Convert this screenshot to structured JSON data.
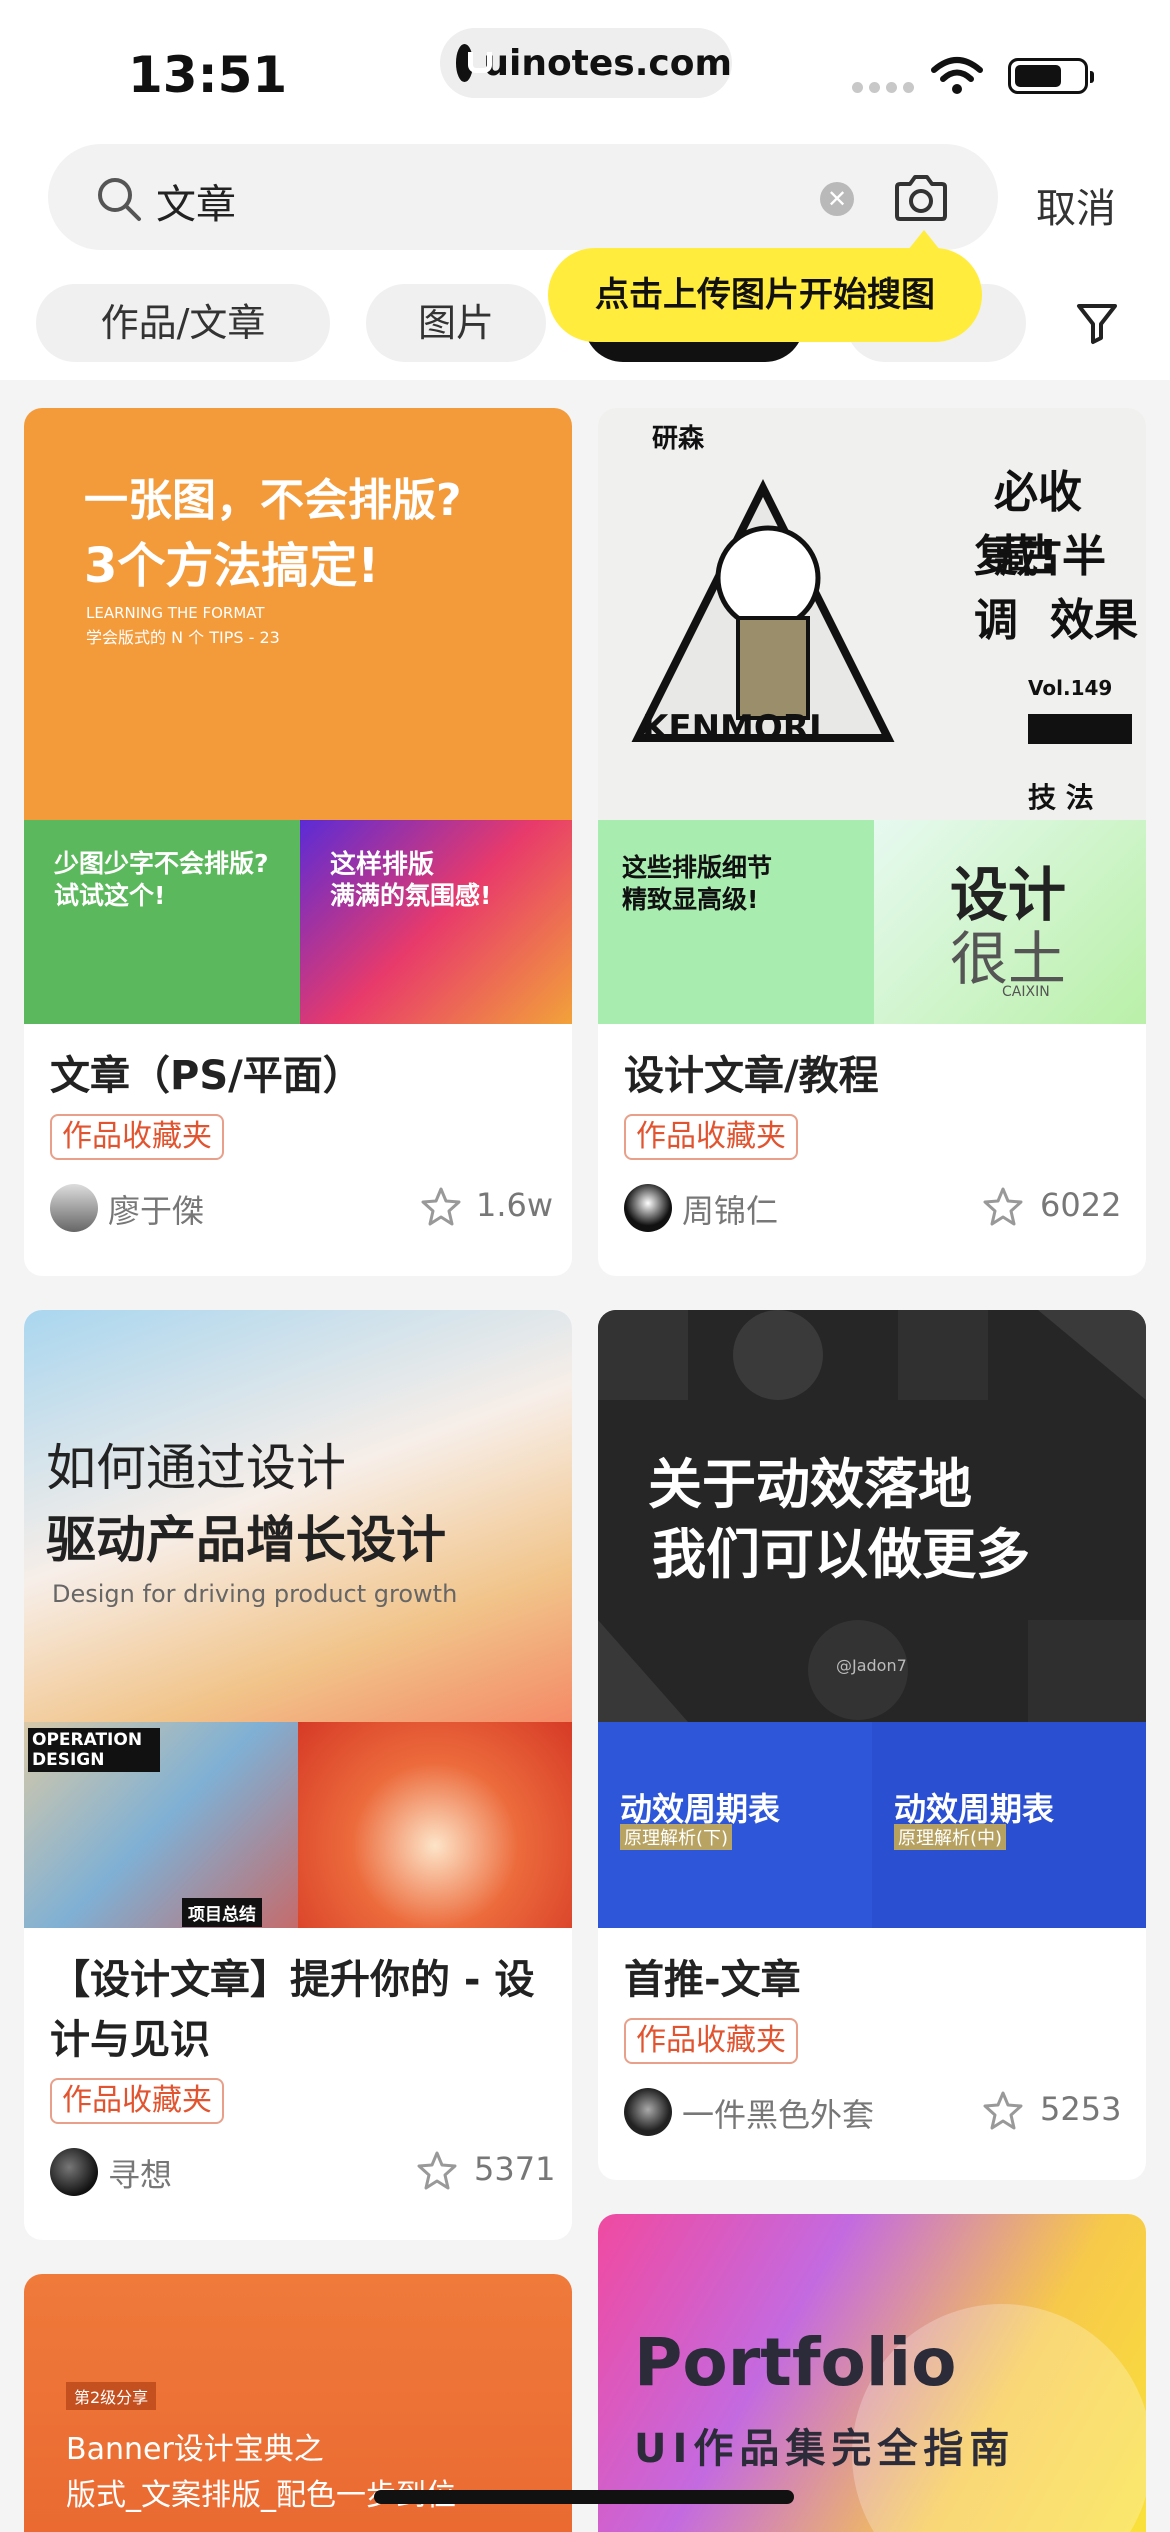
{
  "status_bar": {
    "time": "13:51",
    "url": "uinotes.com"
  },
  "search": {
    "query": "文章",
    "cancel_label": "取消"
  },
  "tooltip": "点击上传图片开始搜图",
  "filters": [
    "作品/文章",
    "图片"
  ],
  "cards": [
    {
      "title": "文章（PS/平面）",
      "tag": "作品收藏夹",
      "author": "廖于傑",
      "stars": "1.6w",
      "cover_text": [
        "一张图，不会排版?",
        "3个方法搞定!",
        "LEARNING THE FORMAT",
        "学会版式的 N 个 TIPS - 23",
        "少图少字不会排版?",
        "试试这个!",
        "这样排版",
        "满满的氛围感!"
      ]
    },
    {
      "title": "设计文章/教程",
      "tag": "作品收藏夹",
      "author": "周锦仁",
      "stars": "6022",
      "cover_text": [
        "研森",
        "必收藏!",
        "复古半调",
        "效果",
        "Vol.149",
        "技  法",
        "KENMORI",
        "这些排版细节",
        "精致显高级!",
        "设计",
        "很土",
        "CAIXIN"
      ]
    },
    {
      "title": "【设计文章】提升你的 - 设计与见识",
      "tag": "作品收藏夹",
      "author": "寻想",
      "stars": "5371",
      "cover_text": [
        "如何通过设计",
        "驱动产品增长设计",
        "Design for driving product growth",
        "OPERATION DESIGN",
        "项目总结"
      ]
    },
    {
      "title": "首推-文章",
      "tag": "作品收藏夹",
      "author": "一件黑色外套",
      "stars": "5253",
      "cover_text": [
        "关于动效落地",
        "我们可以做更多",
        "@Jadon7",
        "动效周期表",
        "原理解析(下)",
        "动效周期表",
        "原理解析(中)"
      ]
    },
    {
      "cover_text": [
        "第2级分享",
        "Banner设计宝典之",
        "版式_文案排版_配色一步到位"
      ]
    },
    {
      "cover_text": [
        "Portfolio",
        "UI作品集完全指南"
      ]
    }
  ],
  "colors": {
    "accent": "#e2542f",
    "tooltip": "#ffec3d"
  }
}
